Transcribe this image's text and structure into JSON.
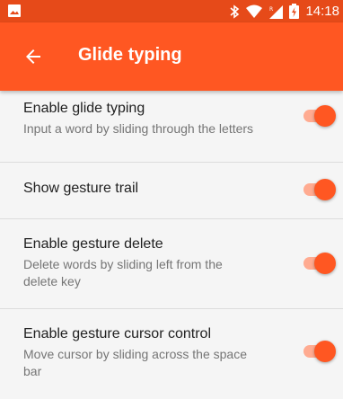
{
  "status_bar": {
    "time": "14:18",
    "icons": [
      "image-icon",
      "bluetooth-icon",
      "wifi-icon",
      "signal-icon",
      "battery-charging-icon"
    ]
  },
  "app_bar": {
    "title": "Glide typing",
    "back_icon": "arrow-back-icon"
  },
  "settings": [
    {
      "title": "Enable glide typing",
      "summary": "Input a word by sliding through the letters",
      "enabled": true
    },
    {
      "title": "Show gesture trail",
      "summary": "",
      "enabled": true
    },
    {
      "title": "Enable gesture delete",
      "summary": "Delete words by sliding left from the delete key",
      "enabled": true
    },
    {
      "title": "Enable gesture cursor control",
      "summary": "Move cursor by sliding across the space bar",
      "enabled": true
    }
  ],
  "colors": {
    "accent": "#ff5722",
    "status_bar": "#e64a19",
    "track_on": "#ffab91",
    "background": "#f5f5f5"
  }
}
